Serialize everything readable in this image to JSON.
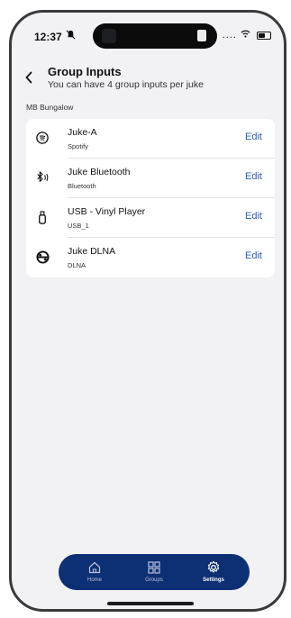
{
  "status_bar": {
    "time": "12:37",
    "signal": "....",
    "icons": [
      "bell-slash-icon",
      "wifi-icon",
      "battery-icon"
    ]
  },
  "header": {
    "back_icon": "chevron-left-icon",
    "title": "Group Inputs",
    "subtitle": "You can have 4 group inputs per juke"
  },
  "location": "MB Bungalow",
  "inputs": [
    {
      "name": "Juke-A",
      "type": "Spotify",
      "icon": "spotify-icon",
      "action": "Edit"
    },
    {
      "name": "Juke Bluetooth",
      "type": "Bluetooth",
      "icon": "bluetooth-icon",
      "action": "Edit"
    },
    {
      "name": "USB - Vinyl Player",
      "type": "USB_1",
      "icon": "usb-icon",
      "action": "Edit"
    },
    {
      "name": "Juke DLNA",
      "type": "DLNA",
      "icon": "dlna-icon",
      "action": "Edit"
    }
  ],
  "tabbar": {
    "tabs": [
      {
        "label": "Home",
        "icon": "home-icon",
        "active": false
      },
      {
        "label": "Groups",
        "icon": "groups-grid-icon",
        "active": false
      },
      {
        "label": "Settings",
        "icon": "settings-gear-icon",
        "active": true
      }
    ]
  },
  "colors": {
    "accent": "#2d5bb3",
    "tabbar": "#0d2f74",
    "background": "#f2f2f4"
  }
}
